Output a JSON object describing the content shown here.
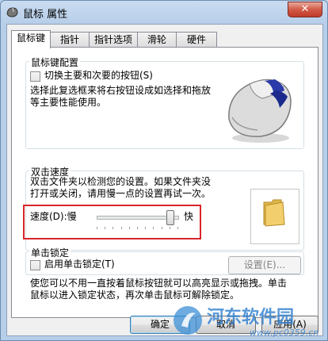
{
  "window": {
    "title": "鼠标 属性",
    "close_label": "✕"
  },
  "tabs": [
    {
      "label": "鼠标键",
      "active": true
    },
    {
      "label": "指针",
      "active": false
    },
    {
      "label": "指针选项",
      "active": false
    },
    {
      "label": "滑轮",
      "active": false
    },
    {
      "label": "硬件",
      "active": false
    }
  ],
  "button_config": {
    "title": "鼠标键配置",
    "swap_label": "切换主要和次要的按钮(S)",
    "swap_checked": false,
    "description": [
      "选择此复选框来将右按钮设成如选择和拖放",
      "等主要性能使用。"
    ]
  },
  "double_click": {
    "title": "双击速度",
    "description": [
      "双击文件夹以检测您的设置。如果文件夹没",
      "打开或关闭，请用慢一点的设置再试一次。"
    ],
    "speed_label": "速度(D):慢",
    "fast_label": "快",
    "speed_fraction": 0.91
  },
  "click_lock": {
    "title": "单击锁定",
    "enable_label": "启用单击锁定(T)",
    "enable_checked": false,
    "settings_button": "设置(E)...",
    "description": [
      "使您可以不用一直按着鼠标按钮就可以高亮显示或拖拽。单击",
      "鼠标以进入锁定状态，再次单击鼠标可解除锁定。"
    ]
  },
  "footer": {
    "ok": "确定",
    "cancel": "取消",
    "apply": "应用(A)"
  },
  "watermark": {
    "brand": "河东软件园",
    "url": "www.pc0359.cn"
  },
  "colors": {
    "highlight": "#d9262b",
    "title_bg": "#b7cee9"
  }
}
